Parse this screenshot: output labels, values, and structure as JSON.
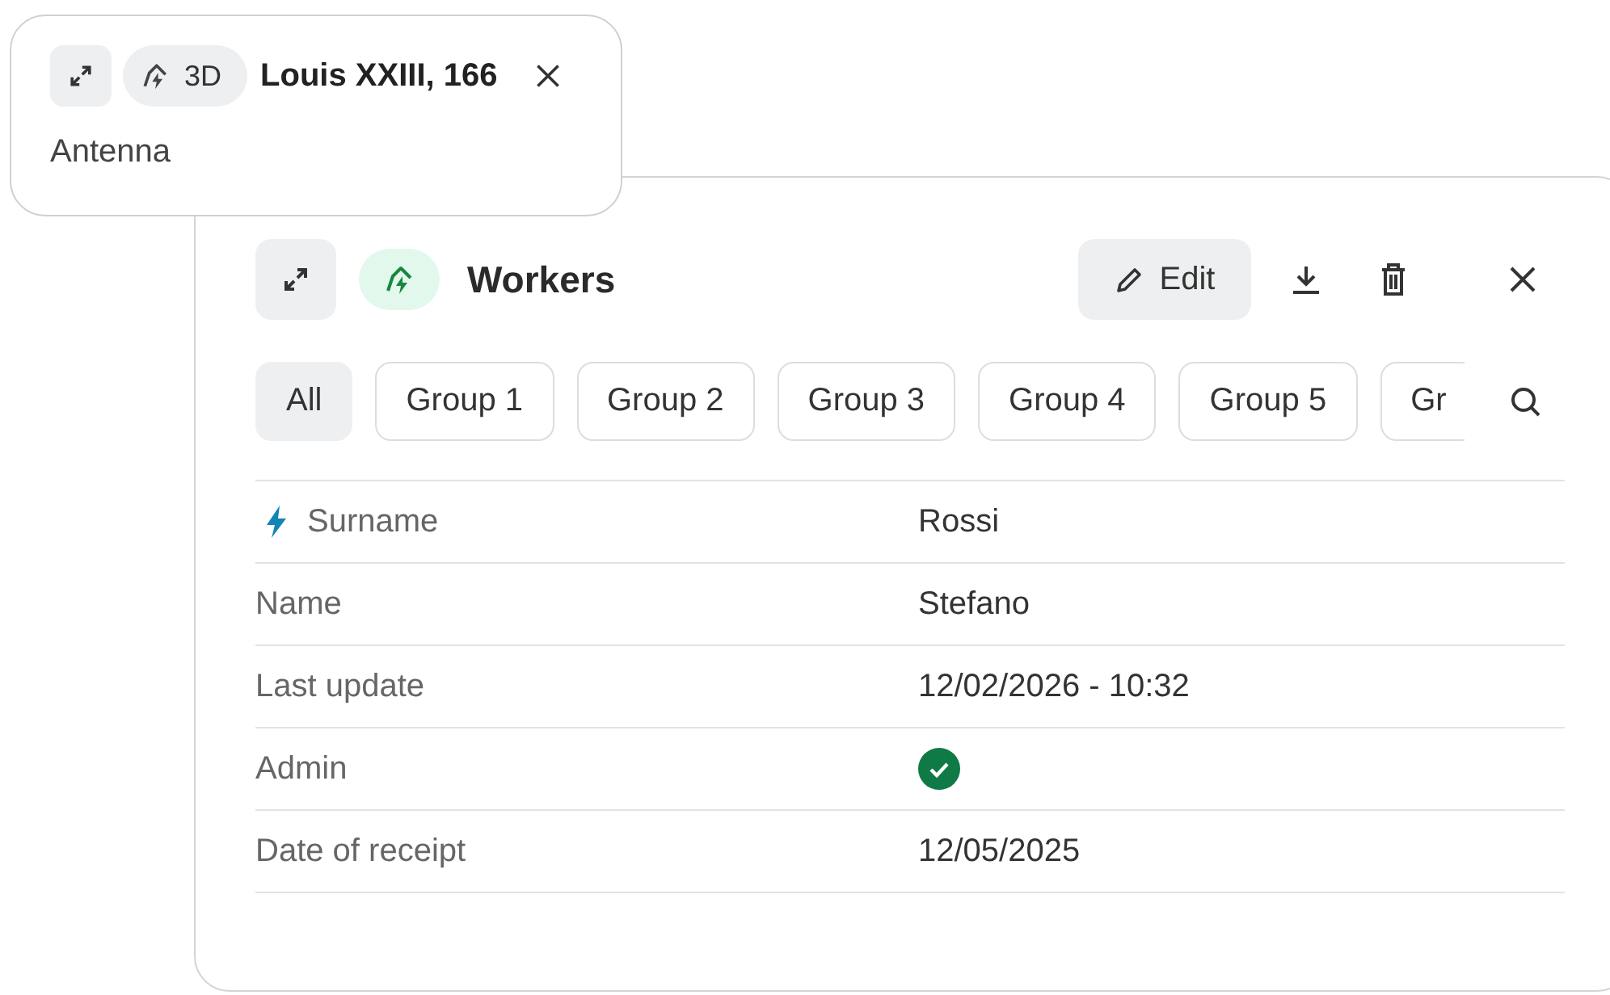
{
  "popup": {
    "badge": "3D",
    "title": "Louis XXIII, 166",
    "subtitle": "Antenna"
  },
  "panel": {
    "title": "Workers",
    "edit_label": "Edit",
    "filters": [
      {
        "label": "All",
        "selected": true
      },
      {
        "label": "Group 1",
        "selected": false
      },
      {
        "label": "Group 2",
        "selected": false
      },
      {
        "label": "Group 3",
        "selected": false
      },
      {
        "label": "Group 4",
        "selected": false
      },
      {
        "label": "Group 5",
        "selected": false
      },
      {
        "label": "Gr",
        "selected": false
      }
    ],
    "fields": [
      {
        "label": "Surname",
        "lightning": true,
        "kind": "text",
        "value": "Rossi"
      },
      {
        "label": "Name",
        "lightning": false,
        "kind": "text",
        "value": "Stefano"
      },
      {
        "label": "Last update",
        "lightning": false,
        "kind": "text",
        "value": "12/02/2026 - 10:32"
      },
      {
        "label": "Admin",
        "lightning": false,
        "kind": "check",
        "checked": true
      },
      {
        "label": "Date of receipt",
        "lightning": false,
        "kind": "text",
        "value": "12/05/2025"
      }
    ]
  }
}
